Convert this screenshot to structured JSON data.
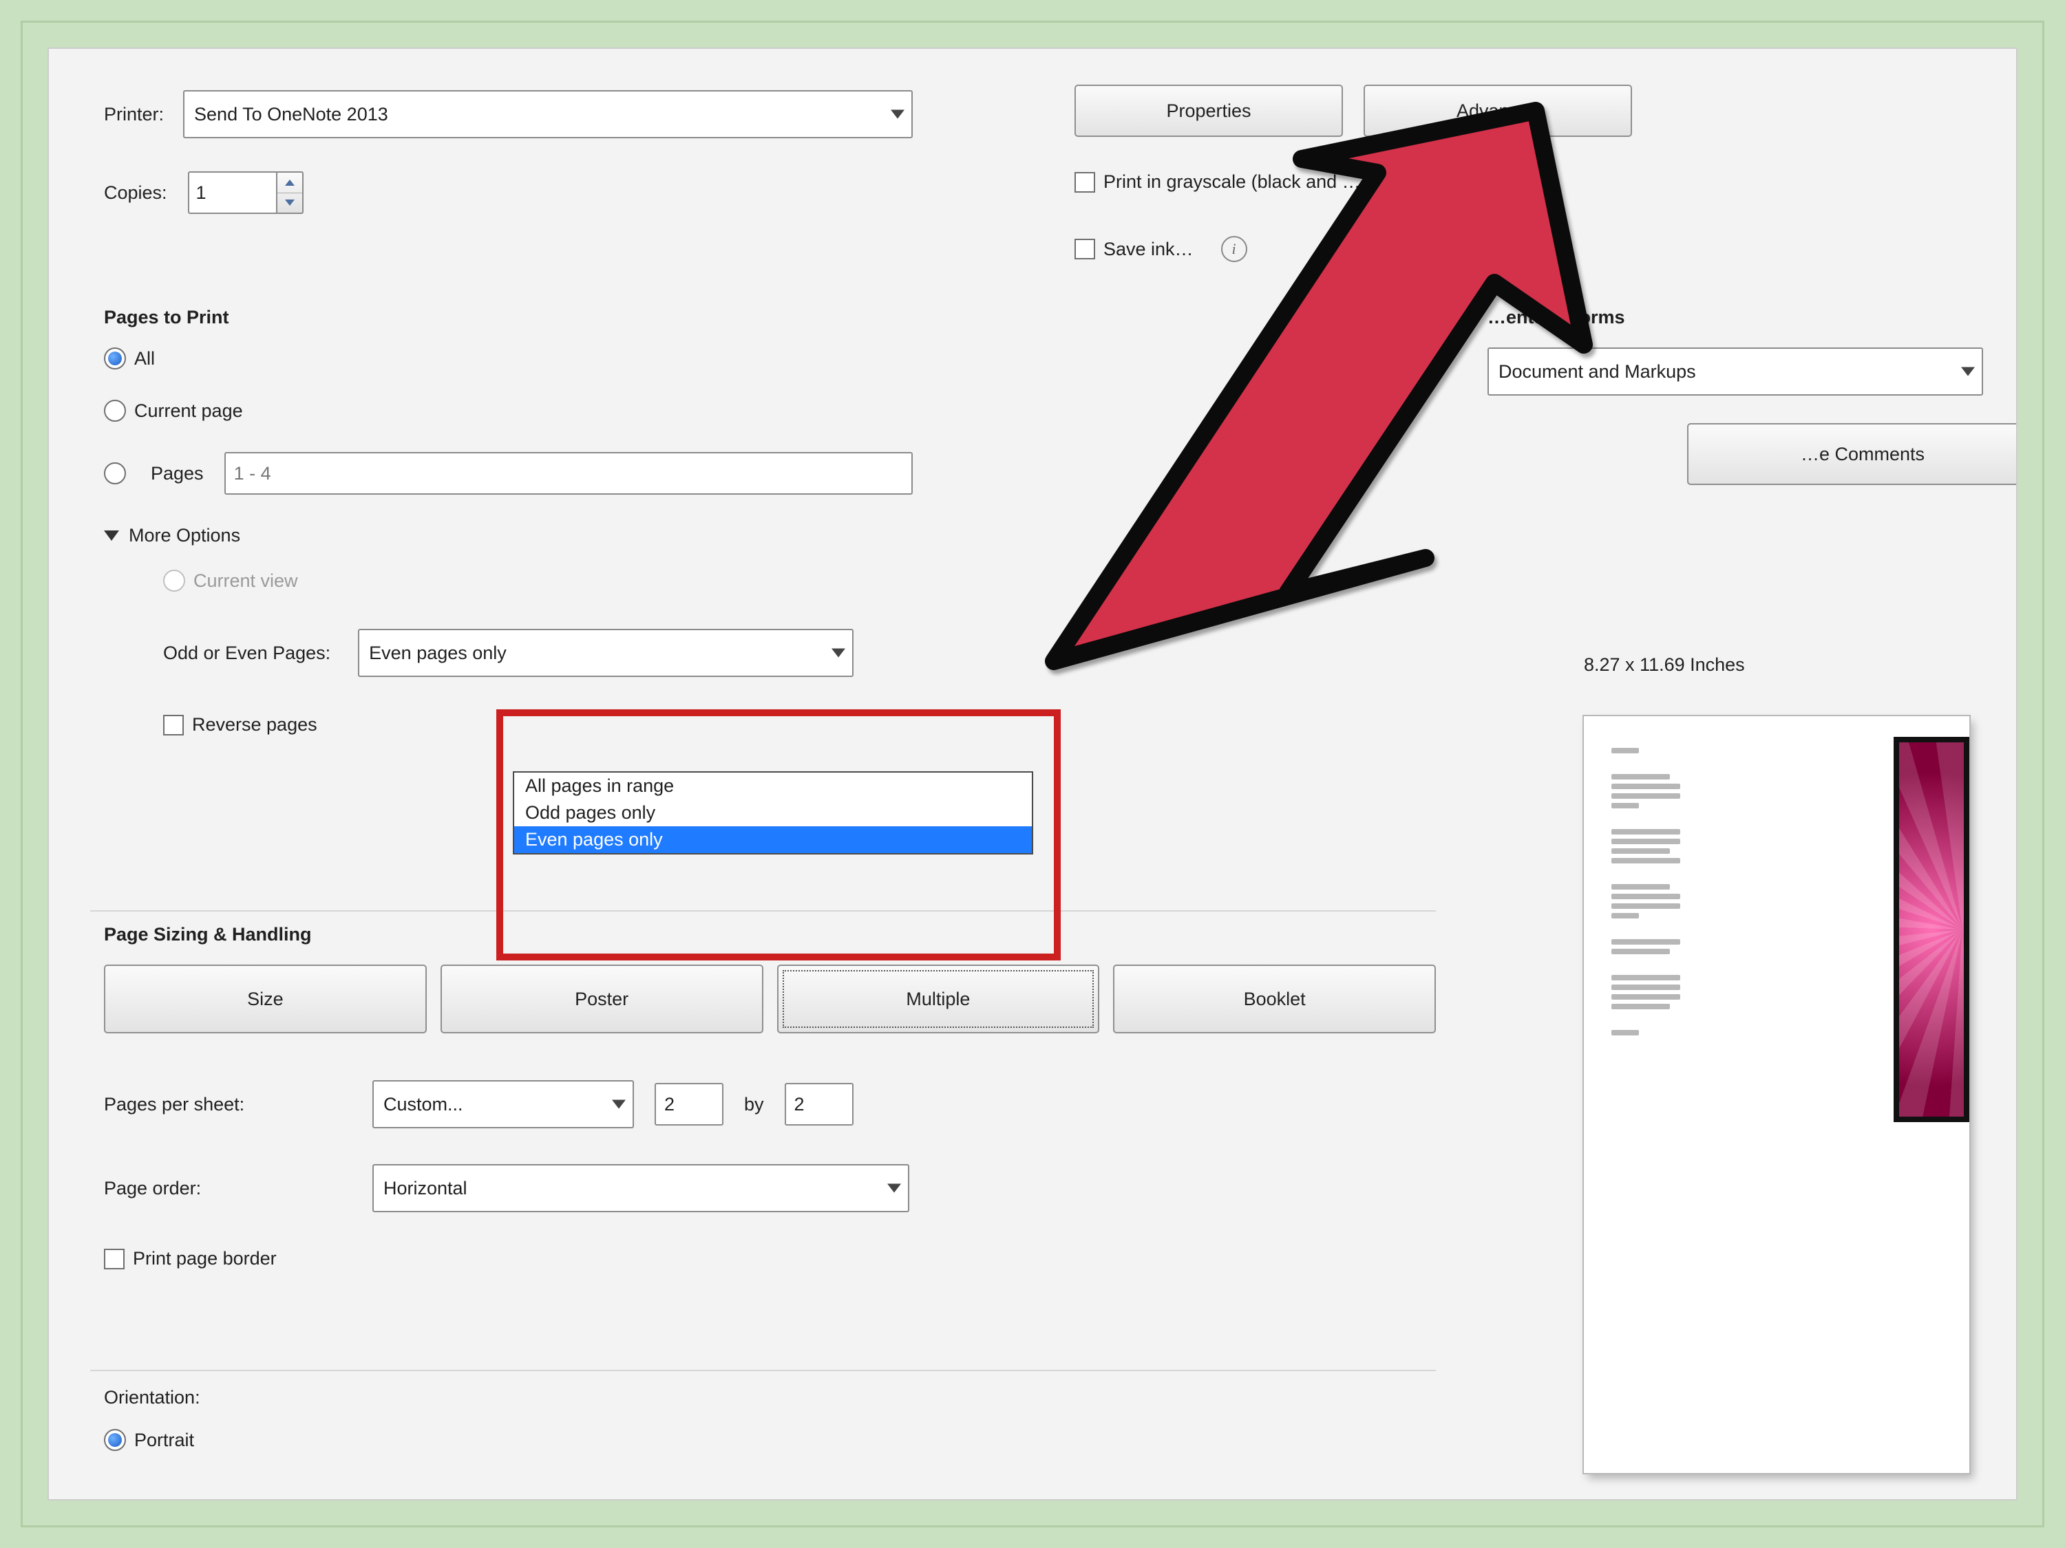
{
  "top": {
    "printer_label": "Printer:",
    "printer_value": "Send To OneNote 2013",
    "copies_label": "Copies:",
    "copies_value": "1",
    "properties_btn": "Properties",
    "advanced_btn": "Advanced",
    "grayscale_label": "Print in grayscale (black and …",
    "save_ink_label": "Save ink…"
  },
  "pages_to_print": {
    "heading": "Pages to Print",
    "all": "All",
    "current_page": "Current page",
    "pages": "Pages",
    "pages_value": "1 - 4",
    "more_options": "More Options",
    "current_view": "Current view",
    "odd_even_label": "Odd or Even Pages:",
    "odd_even_value": "Even pages only",
    "odd_even_options": [
      "All pages in range",
      "Odd pages only",
      "Even pages only"
    ],
    "reverse_pages": "Reverse pages"
  },
  "sizing": {
    "heading": "Page Sizing & Handling",
    "size_btn": "Size",
    "poster_btn": "Poster",
    "multiple_btn": "Multiple",
    "booklet_btn": "Booklet",
    "pages_per_sheet_label": "Pages per sheet:",
    "pages_per_sheet_value": "Custom...",
    "pps_cols": "2",
    "pps_by": "by",
    "pps_rows": "2",
    "page_order_label": "Page order:",
    "page_order_value": "Horizontal",
    "print_border": "Print page border"
  },
  "orientation": {
    "heading": "Orientation:",
    "portrait": "Portrait"
  },
  "right": {
    "comments_forms_heading": "…ents & Forms",
    "doc_markups": "Document and Markups",
    "summarize_btn": "…e Comments",
    "paper_size": "8.27 x 11.69 Inches"
  }
}
